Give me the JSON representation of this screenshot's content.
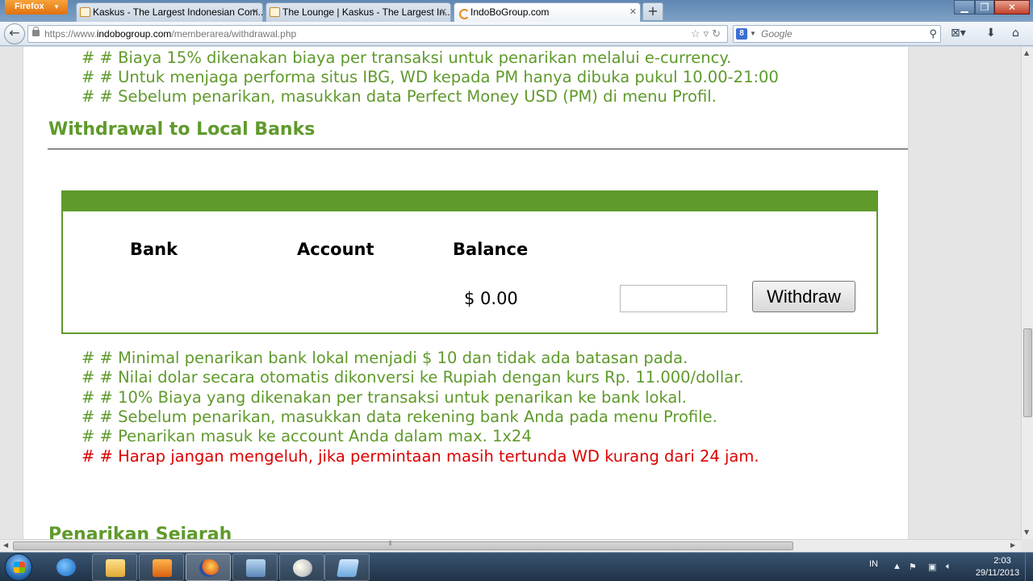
{
  "browser": {
    "app_button": "Firefox",
    "tabs": [
      {
        "title": "Kaskus - The Largest Indonesian Com...",
        "active": false
      },
      {
        "title": "The Lounge | Kaskus - The Largest In...",
        "active": false
      },
      {
        "title": "IndoBoGroup.com",
        "active": true
      }
    ],
    "close_glyph": "✕",
    "newtab_glyph": "+",
    "url_prefix": "https://www.",
    "url_domain": "indobogroup.com",
    "url_path": "/memberarea/withdrawal.php",
    "search_placeholder": "Google",
    "search_engine_letter": "8"
  },
  "page": {
    "ecurrency_notes": [
      "# # Biaya 15% dikenakan biaya per transaksi untuk penarikan melalui e-currency.",
      "# # Untuk menjaga performa situs IBG, WD kepada PM hanya dibuka pukul 10.00-21:00",
      "# # Sebelum penarikan, masukkan data Perfect Money USD (PM) di menu Profil."
    ],
    "local_bank_title": "Withdrawal to Local Banks",
    "table": {
      "headers": [
        "Bank",
        "Account",
        "Balance"
      ],
      "balance": "$ 0.00",
      "amount_value": "",
      "withdraw_label": "Withdraw"
    },
    "bank_notes": [
      "# # Minimal penarikan bank lokal menjadi $ 10 dan tidak ada batasan pada.",
      "# # Nilai dolar secara otomatis dikonversi ke Rupiah dengan kurs Rp. 11.000/dollar.",
      "# # 10% Biaya yang dikenakan per transaksi untuk penarikan ke bank lokal.",
      "# # Sebelum penarikan, masukkan data rekening bank Anda pada menu Profile.",
      "# # Penarikan masuk ke account Anda dalam max. 1x24"
    ],
    "warning_note": "# # Harap jangan mengeluh, jika permintaan masih tertunda WD kurang dari 24 jam.",
    "history_title": "Penarikan Sejarah",
    "colors": {
      "green": "#5f9a2b",
      "warning": "#dd0000"
    }
  },
  "taskbar": {
    "language": "IN",
    "time": "2:03",
    "date": "29/11/2013",
    "apps": [
      "internet-explorer",
      "windows-explorer",
      "media-player",
      "firefox",
      "remote-desktop",
      "paint",
      "app"
    ]
  }
}
